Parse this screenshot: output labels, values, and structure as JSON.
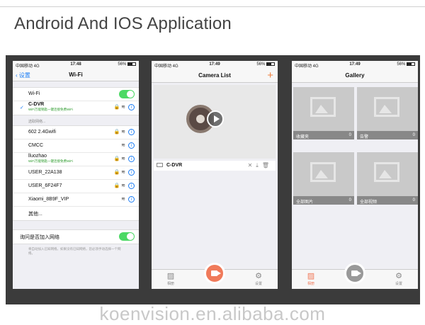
{
  "title": "Android And IOS Application",
  "watermark": "koenvision.en.alibaba.com",
  "phone1": {
    "status": {
      "carrier": "中国移动 4G",
      "time": "17:48",
      "battery": "56%"
    },
    "back_label": "设置",
    "nav_title": "Wi-Fi",
    "wifi_label": "Wi-Fi",
    "connected": {
      "name": "C-DVR",
      "sub": "WiFi万能钥匙一键连接免费WiFi"
    },
    "section_label": "选取网络...",
    "networks": [
      {
        "name": "602 2.4Gwifi"
      },
      {
        "name": "CMCC"
      },
      {
        "name": "lluozhao",
        "sub": "WiFi万能钥匙一键连接免费WiFi"
      },
      {
        "name": "USER_22A138"
      },
      {
        "name": "USER_6F24F7"
      },
      {
        "name": "Xiaomi_8B9F_VIP"
      },
      {
        "name": "其他..."
      }
    ],
    "ask_join": "询问是否加入网络",
    "footnote": "将自动加入已知网络。如果没有已知网络，您必须手动选择一个网络。"
  },
  "phone2": {
    "status": {
      "carrier": "中国移动 4G",
      "time": "17:49",
      "battery": "56%"
    },
    "nav_title": "Camera List",
    "camera_name": "C-DVR",
    "tabs": {
      "left": "相册",
      "right": "设置"
    }
  },
  "phone3": {
    "status": {
      "carrier": "中国移动 4G",
      "time": "17:49",
      "battery": "56%"
    },
    "nav_title": "Gallery",
    "tiles": [
      {
        "label": "收藏夹",
        "count": "0"
      },
      {
        "label": "告警",
        "count": "0"
      },
      {
        "label": "全部图片",
        "count": "0"
      },
      {
        "label": "全部视频",
        "count": "0"
      }
    ],
    "tabs": {
      "left": "相册",
      "right": "设置"
    }
  },
  "colors": {
    "accent_orange": "#f07a5a",
    "ios_blue": "#1a7cf5",
    "toggle_green": "#4cd964"
  }
}
